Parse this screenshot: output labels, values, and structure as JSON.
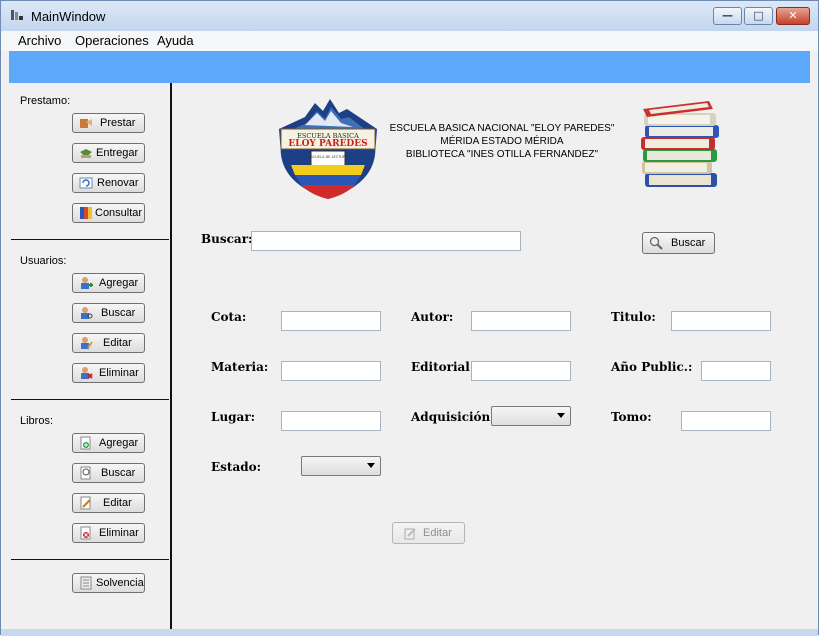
{
  "window": {
    "title": "MainWindow"
  },
  "menu": [
    "Archivo",
    "Operaciones",
    "Ayuda"
  ],
  "sidebar": {
    "prestamo": {
      "label": "Prestamo:",
      "buttons": [
        {
          "label": "Prestar",
          "icon": "lend-icon"
        },
        {
          "label": "Entregar",
          "icon": "return-icon"
        },
        {
          "label": "Renovar",
          "icon": "renew-icon"
        },
        {
          "label": "Consultar",
          "icon": "query-icon"
        }
      ]
    },
    "usuarios": {
      "label": "Usuarios:",
      "buttons": [
        {
          "label": "Agregar",
          "icon": "user-add-icon"
        },
        {
          "label": "Buscar",
          "icon": "user-search-icon"
        },
        {
          "label": "Editar",
          "icon": "user-edit-icon"
        },
        {
          "label": "Eliminar",
          "icon": "user-delete-icon"
        }
      ]
    },
    "libros": {
      "label": "Libros:",
      "buttons": [
        {
          "label": "Agregar",
          "icon": "book-add-icon"
        },
        {
          "label": "Buscar",
          "icon": "book-search-icon"
        },
        {
          "label": "Editar",
          "icon": "book-edit-icon"
        },
        {
          "label": "Eliminar",
          "icon": "book-delete-icon"
        }
      ]
    },
    "solvencia": {
      "label": "Solvencia",
      "icon": "document-icon"
    }
  },
  "header": {
    "logo_text_1": "ESCUELA BASICA",
    "logo_text_2": "ELOY PAREDES",
    "logo_text_3": "ESCUELA DE LECTURA",
    "line1": "ESCUELA BASICA NACIONAL \"ELOY PAREDES\"",
    "line2": "MÉRIDA ESTADO MÉRIDA",
    "line3": "BIBLIOTECA \"INES OTILLA FERNANDEZ\""
  },
  "search": {
    "label": "Buscar:",
    "value": "",
    "button": "Buscar"
  },
  "form": {
    "cota": "Cota:",
    "autor": "Autor:",
    "titulo": "Titulo:",
    "materia": "Materia:",
    "editorial": "Editorial:",
    "anio": "Año Public.:",
    "lugar": "Lugar:",
    "adquisicion": "Adquisición:",
    "tomo": "Tomo:",
    "estado": "Estado:",
    "editar_button": "Editar"
  },
  "colors": {
    "accent_strip": "#5ea8fb"
  }
}
